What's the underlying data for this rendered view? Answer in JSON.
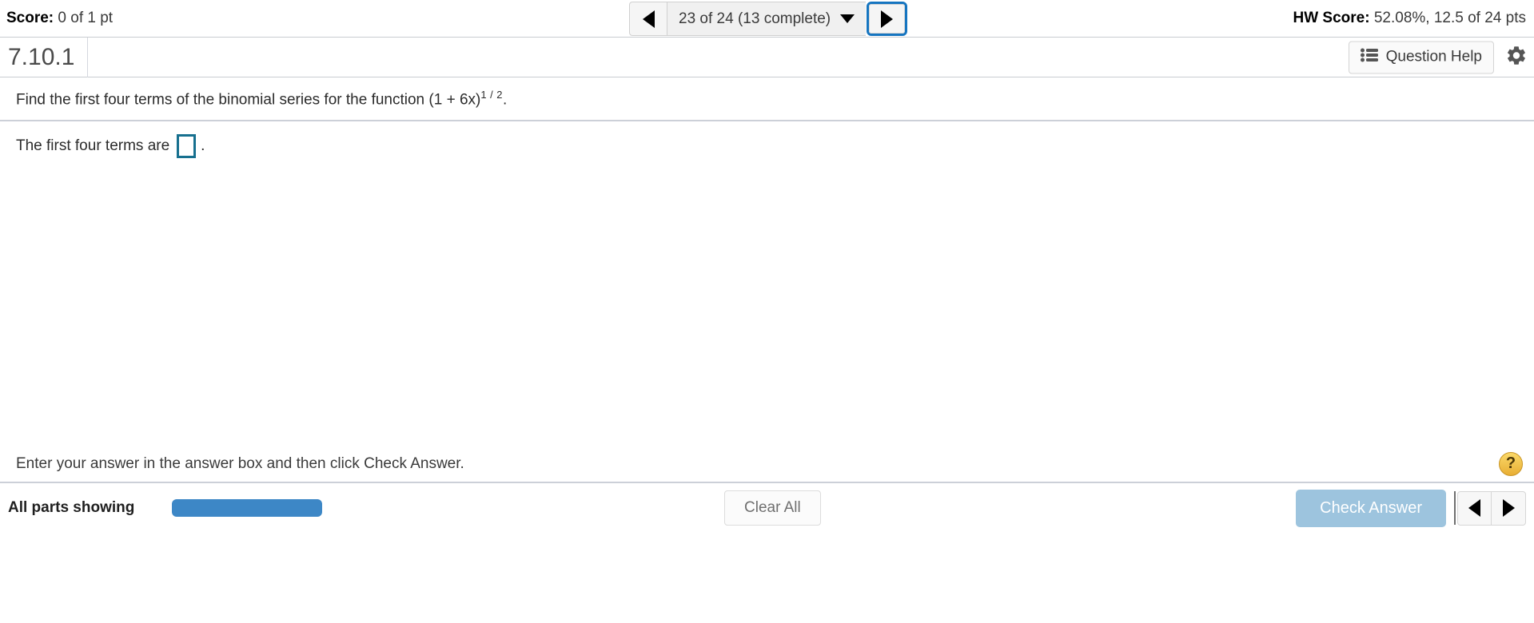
{
  "topbar": {
    "score_label": "Score:",
    "score_value": " 0 of 1 pt",
    "hw_score_label": "HW Score:",
    "hw_score_value": " 52.08%, 12.5 of 24 pts",
    "nav": {
      "prev_icon": "triangle-left-icon",
      "next_icon": "triangle-right-icon",
      "selector_text": "23 of 24 (13 complete)",
      "selector_caret_icon": "caret-down-icon"
    }
  },
  "idrow": {
    "question_id": "7.10.1",
    "question_help_label": "Question Help",
    "question_help_icon": "bulleted-list-icon",
    "settings_icon": "gear-icon"
  },
  "problem": {
    "prompt_prefix": "Find the first four terms of the binomial series for the function (1 + 6x)",
    "prompt_exponent": "1 / 2",
    "prompt_suffix": ".",
    "answer_prefix": "The first four terms are",
    "answer_value": "",
    "answer_placeholder": "",
    "answer_suffix": "."
  },
  "footer": {
    "hint": "Enter your answer in the answer box and then click Check Answer.",
    "help_icon_label": "?"
  },
  "actionbar": {
    "parts_label": "All parts showing",
    "progress_percent": 100,
    "clear_all_label": "Clear All",
    "check_answer_label": "Check Answer",
    "pager_prev_icon": "triangle-left-icon",
    "pager_next_icon": "triangle-right-icon"
  },
  "colors": {
    "accent_blue": "#1675c0",
    "progress_blue": "#3d87c6",
    "check_answer_blue": "#9dc4de",
    "answer_box_teal": "#17708f",
    "help_yellow": "#e8ae34"
  }
}
